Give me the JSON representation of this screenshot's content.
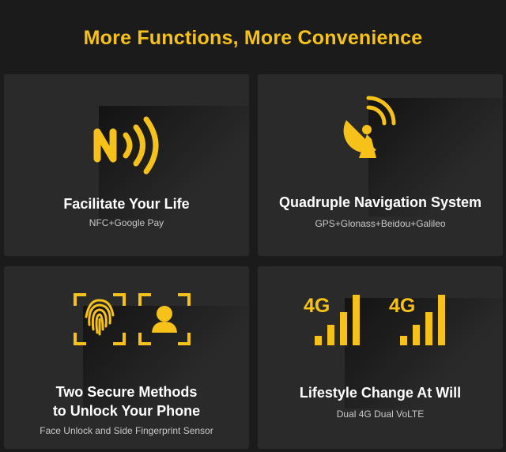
{
  "headline": "More Functions, More Convenience",
  "accent_color": "#f6c21a",
  "cards": [
    {
      "icon": "nfc-icon",
      "title": "Facilitate Your Life",
      "subtitle": "NFC+Google Pay"
    },
    {
      "icon": "satellite-dish-icon",
      "title": "Quadruple Navigation System",
      "subtitle": "GPS+Glonass+Beidou+Galileo"
    },
    {
      "icon": "fingerprint-face-unlock-icon",
      "title_lines": [
        "Two Secure Methods",
        "to Unlock Your Phone"
      ],
      "subtitle": "Face Unlock and Side Fingerprint Sensor"
    },
    {
      "icon": "dual-4g-signal-icon",
      "title": "Lifestyle Change At Will",
      "subtitle": "Dual 4G Dual VoLTE",
      "badges": [
        "4G",
        "4G"
      ]
    }
  ]
}
